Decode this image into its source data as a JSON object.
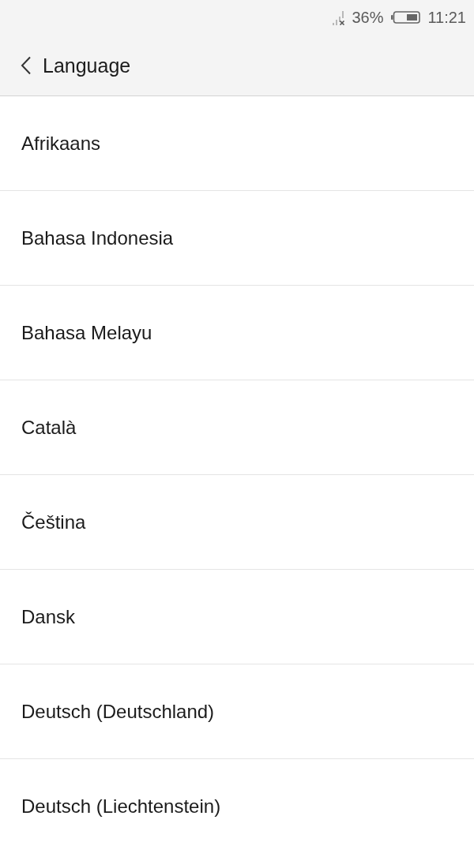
{
  "status_bar": {
    "battery": "36%",
    "time": "11:21"
  },
  "header": {
    "title": "Language"
  },
  "languages": [
    "Afrikaans",
    "Bahasa Indonesia",
    "Bahasa Melayu",
    "Català",
    "Čeština",
    "Dansk",
    "Deutsch (Deutschland)",
    "Deutsch (Liechtenstein)"
  ]
}
